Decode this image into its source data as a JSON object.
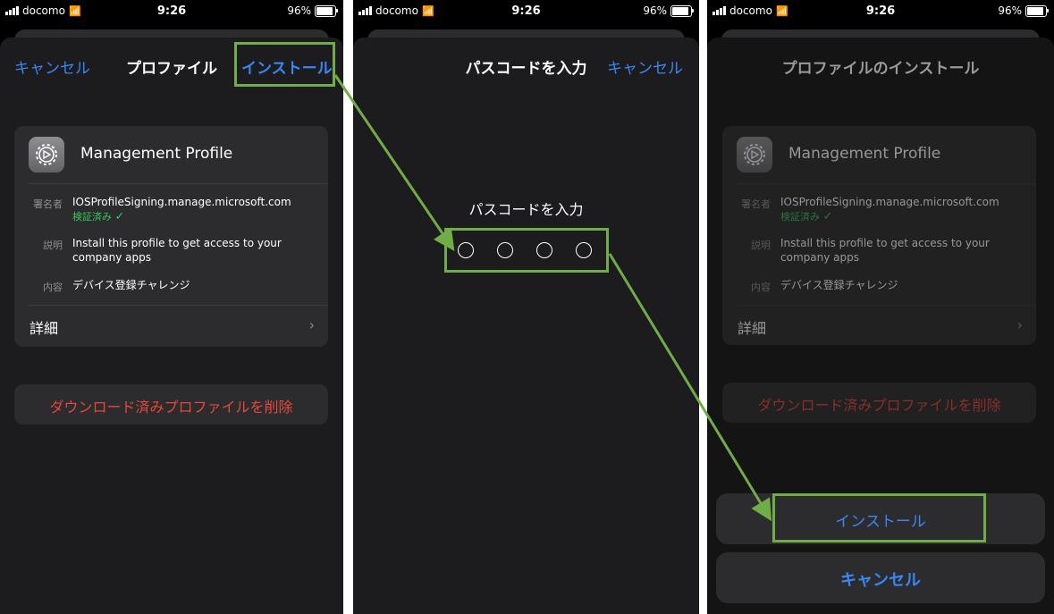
{
  "status_bar": {
    "carrier": "docomo",
    "time": "9:26",
    "battery": "96%"
  },
  "screen1": {
    "cancel": "キャンセル",
    "title": "プロファイル",
    "install": "インストール",
    "profile_name": "Management Profile",
    "signer_label": "署名者",
    "signer_value": "IOSProfileSigning.manage.microsoft.com",
    "verified": "検証済み",
    "desc_label": "説明",
    "desc_line1": "Install this profile to get access to your",
    "desc_line2": "company apps",
    "contents_label": "内容",
    "contents_value": "デバイス登録チャレンジ",
    "more_details": "詳細",
    "delete": "ダウンロード済みプロファイルを削除"
  },
  "screen2": {
    "title": "パスコードを入力",
    "cancel": "キャンセル",
    "prompt": "パスコードを入力",
    "passcode_length": 4
  },
  "screen3": {
    "title": "プロファイルのインストール",
    "install": "インストール",
    "cancel": "キャンセル"
  },
  "colors": {
    "accent": "#3a86f2",
    "highlight": "#70ad47",
    "destructive": "#e5483c",
    "verified": "#34c759"
  }
}
